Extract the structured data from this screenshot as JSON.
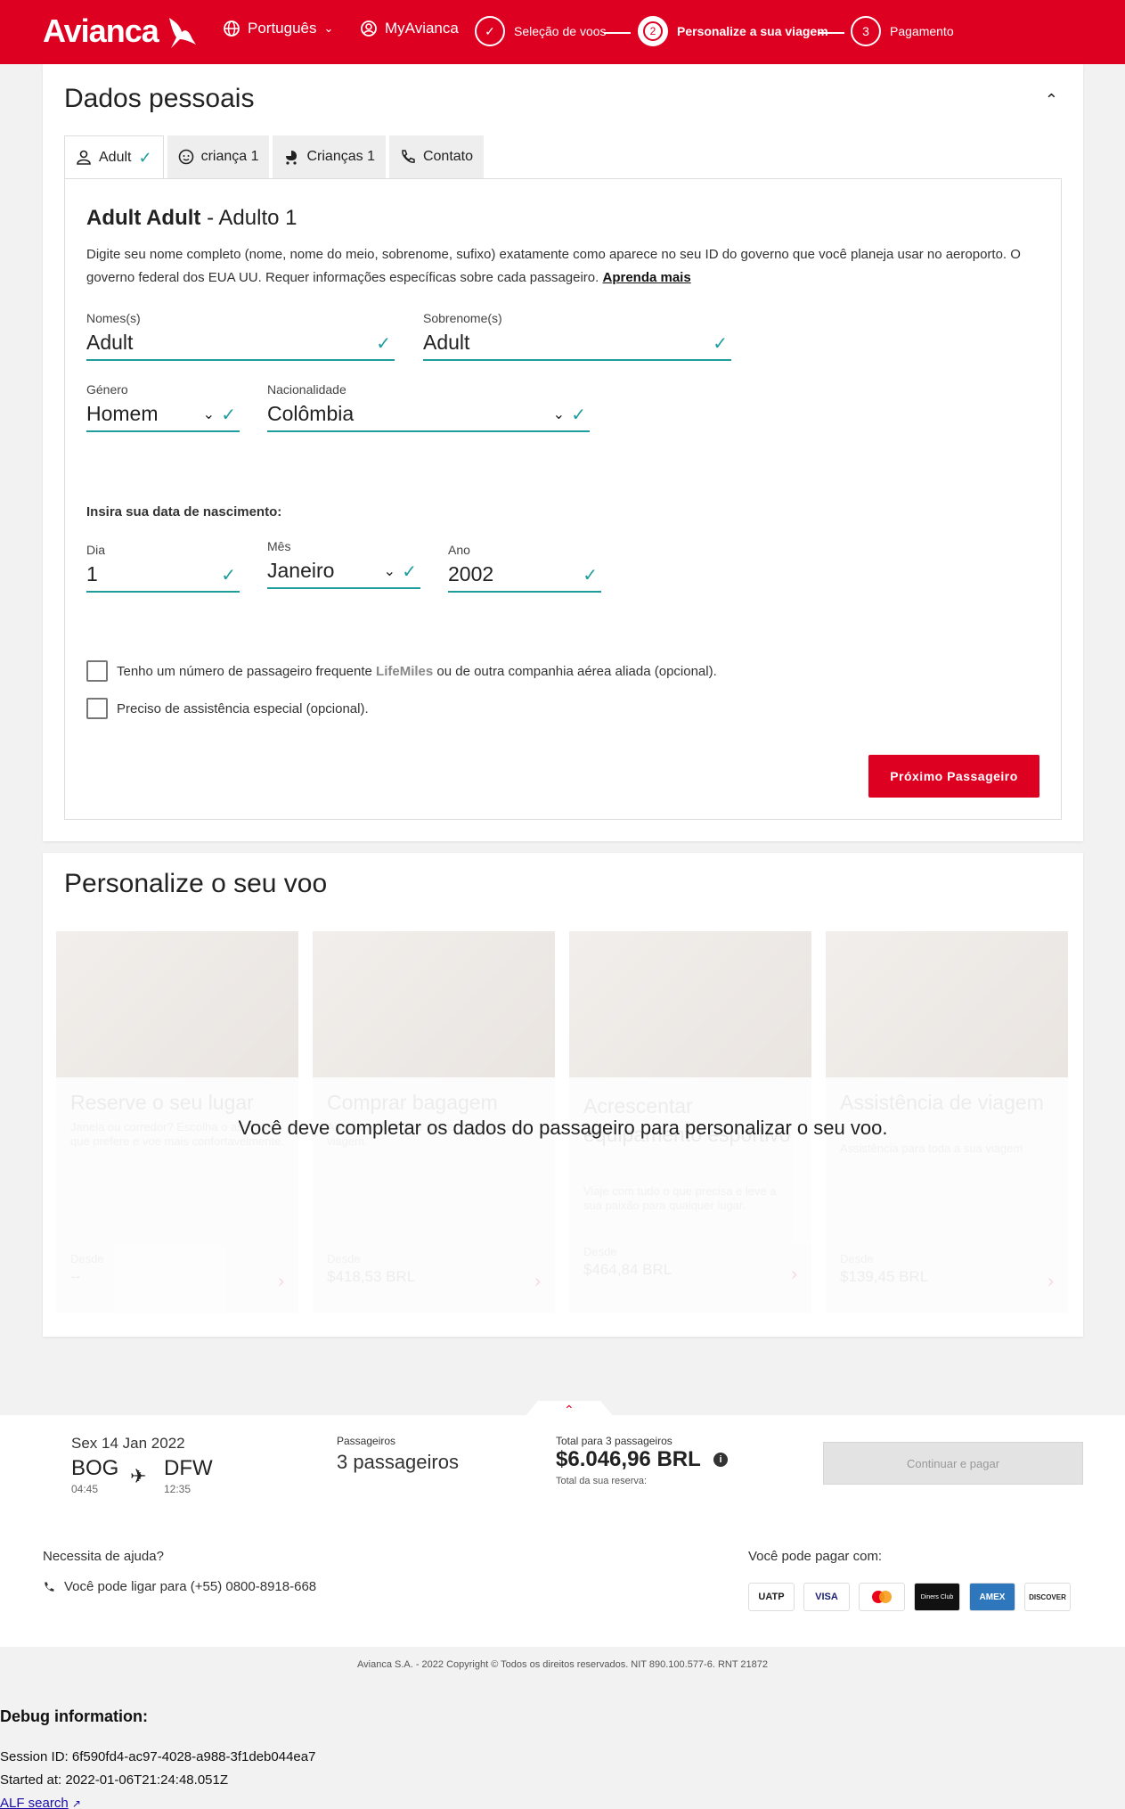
{
  "header": {
    "brand": "Avianca",
    "language": "Português",
    "myaccount": "MyAvianca",
    "steps": [
      {
        "num": "",
        "label": "Seleção de voos"
      },
      {
        "num": "2",
        "label": "Personalize a sua viagem"
      },
      {
        "num": "3",
        "label": "Pagamento"
      }
    ]
  },
  "personal": {
    "title": "Dados pessoais",
    "tabs": [
      "Adult",
      "criança 1",
      "Crianças 1",
      "Contato"
    ],
    "passenger_name": "Adult Adult",
    "passenger_suffix": " - Adulto 1",
    "desc": "Digite seu nome completo (nome, nome do meio, sobrenome, sufixo) exatamente como aparece no seu ID do governo que você planeja usar no aeroporto. O governo federal dos EUA UU. Requer informações específicas sobre cada passageiro. ",
    "learn_more": "Aprenda mais",
    "fields": {
      "first_name": {
        "label": "Nomes(s)",
        "value": "Adult"
      },
      "last_name": {
        "label": "Sobrenome(s)",
        "value": "Adult"
      },
      "gender": {
        "label": "Género",
        "value": "Homem"
      },
      "nationality": {
        "label": "Nacionalidade",
        "value": "Colômbia"
      },
      "day": {
        "label": "Dia",
        "value": "1"
      },
      "month": {
        "label": "Mês",
        "value": "Janeiro"
      },
      "year": {
        "label": "Ano",
        "value": "2002"
      }
    },
    "dob_heading": "Insira sua data de nascimento:",
    "check_freq_a": "Tenho um número de passageiro frequente ",
    "check_freq_lm": "LifeMiles",
    "check_freq_b": " ou de outra companhia aérea aliada (opcional).",
    "check_assist": "Preciso de assistência especial (opcional).",
    "next_button": "Próximo Passageiro"
  },
  "customize": {
    "title": "Personalize o seu voo",
    "message": "Você deve completar os dados do passageiro para personalizar o seu voo.",
    "from_label": "Desde",
    "cards": [
      {
        "title": "Reserve o seu lugar",
        "desc": "Janela ou corredor? Escolha o assento que prefere e voe mais confortavelmente.",
        "price": "--"
      },
      {
        "title": "Comprar bagagem",
        "desc": "Arrume tudo o que quiser para a sua viagem.",
        "price": "$418,53 BRL"
      },
      {
        "title": "Acrescentar equipamento esportivo",
        "desc": "Viaje com tudo o que precisa e leve a sua paixão para qualquer lugar.",
        "price": "$464,84 BRL"
      },
      {
        "title": "Assistência de viagem",
        "desc": "Assistência para toda a sua viagem",
        "price": "$139,45 BRL"
      }
    ]
  },
  "summary": {
    "date": "Sex 14 Jan 2022",
    "origin": "BOG",
    "origin_time": "04:45",
    "destination": "DFW",
    "destination_time": "12:35",
    "passengers_label": "Passageiros",
    "passengers_value": "3 passageiros",
    "total_label": "Total para 3 passageiros",
    "total_value": "$6.046,96 BRL",
    "total_sub": "Total da sua reserva:",
    "pay_button": "Continuar e pagar"
  },
  "footer": {
    "help_title": "Necessita de ajuda?",
    "help_phone": "Você pode ligar para (+55) 0800-8918-668",
    "pay_title": "Você pode pagar com:",
    "cards": [
      "UATP",
      "VISA",
      "mastercard",
      "Diners Club",
      "AMEX",
      "DISCOVER"
    ],
    "copyright": "Avianca S.A. - 2022 Copyright © Todos os direitos reservados. NIT 890.100.577-6. RNT 21872"
  },
  "debug": {
    "title": "Debug information:",
    "session": "Session ID: 6f590fd4-ac97-4028-a988-3f1deb044ea7",
    "started": "Started at: 2022-01-06T21:24:48.051Z",
    "link": "ALF search"
  },
  "colors": {
    "brand_red": "#dd0021",
    "teal": "#1f9c9c"
  }
}
